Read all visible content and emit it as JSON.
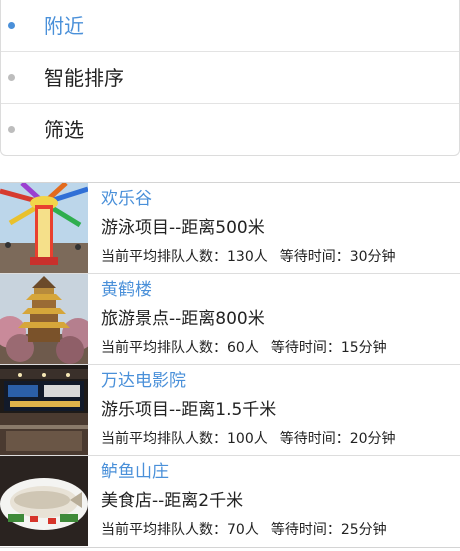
{
  "filters": [
    {
      "label": "附近",
      "active": true
    },
    {
      "label": "智能排序",
      "active": false
    },
    {
      "label": "筛选",
      "active": false
    }
  ],
  "places": [
    {
      "name": "欢乐谷",
      "desc": "游泳项目--距离500米",
      "queue": "当前平均排队人数：130人",
      "wait": "等待时间：30分钟",
      "image": "amusement-ride"
    },
    {
      "name": "黄鹤楼",
      "desc": "旅游景点--距离800米",
      "queue": "当前平均排队人数：60人",
      "wait": "等待时间：15分钟",
      "image": "pagoda"
    },
    {
      "name": "万达电影院",
      "desc": "游乐项目--距离1.5千米",
      "queue": "当前平均排队人数：100人",
      "wait": "等待时间：20分钟",
      "image": "cinema-lobby"
    },
    {
      "name": "鲈鱼山庄",
      "desc": "美食店--距离2千米",
      "queue": "当前平均排队人数：70人",
      "wait": "等待时间：25分钟",
      "image": "fish-dish"
    }
  ],
  "colors": {
    "accent": "#4a90d9",
    "text": "#222222",
    "dot": "#bdbdbd"
  }
}
